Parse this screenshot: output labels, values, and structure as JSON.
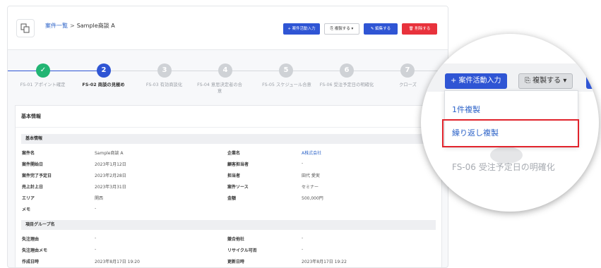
{
  "header": {
    "breadcrumb_link": "案件一覧",
    "breadcrumb_sep": ">",
    "breadcrumb_current": "Sample商談 A",
    "btn_activity": "+ 案件活動入力",
    "btn_duplicate": "⎘ 複製する ▾",
    "btn_edit": "✎ 編集する",
    "btn_delete": "🗑 削除する"
  },
  "steps": [
    {
      "num": "✓",
      "label": "FS-01 アポイント確定",
      "state": "done"
    },
    {
      "num": "2",
      "label": "FS-02 商談の見極め",
      "state": "active"
    },
    {
      "num": "3",
      "label": "FS-03 有効商談化",
      "state": "todo"
    },
    {
      "num": "4",
      "label": "FS-04 意思決定者の合意",
      "state": "todo"
    },
    {
      "num": "5",
      "label": "FS-05 スケジュール合意",
      "state": "todo"
    },
    {
      "num": "6",
      "label": "FS-06 受注予定日の明確化",
      "state": "todo"
    },
    {
      "num": "7",
      "label": "クローズ",
      "state": "todo"
    }
  ],
  "card": {
    "title": "基本情報",
    "section1": "基本情報",
    "section2": "項目グループ名",
    "fields1": [
      {
        "label": "案件名",
        "value": "Sample商談 A",
        "label2": "企業名",
        "value2": "A株式会社"
      },
      {
        "label": "案件開始日",
        "value": "2023年1月12日",
        "label2": "顧客担当者",
        "value2": "-"
      },
      {
        "label": "案件完了予定日",
        "value": "2023年2月28日",
        "label2": "担当者",
        "value2": "田代 愛実"
      },
      {
        "label": "売上計上日",
        "value": "2023年3月31日",
        "label2": "案件ソース",
        "value2": "セミナー"
      },
      {
        "label": "エリア",
        "value": "関西",
        "label2": "金額",
        "value2": "500,000円"
      },
      {
        "label": "メモ",
        "value": "-",
        "label2": "",
        "value2": ""
      }
    ],
    "fields2": [
      {
        "label": "失注理由",
        "value": "-",
        "label2": "競合他社",
        "value2": "-"
      },
      {
        "label": "失注理由メモ",
        "value": "-",
        "label2": "リサイクル可否",
        "value2": "-"
      },
      {
        "label": "作成日時",
        "value": "2023年8月17日 19:20",
        "label2": "更新日時",
        "value2": "2023年8月17日 19:22"
      }
    ]
  },
  "zoom": {
    "btn_activity": "+ 案件活動入力",
    "btn_duplicate": "⎘ 複製する ▾",
    "menu_item_1": "1件複製",
    "menu_item_2": "繰り返し複製",
    "step_label": "FS-06 受注予定日の明確化"
  },
  "colors": {
    "accent": "#2f55d4",
    "done": "#22b573",
    "danger": "#e8323c",
    "step_todo": "#cfd2d6",
    "link": "#2d63c8"
  }
}
